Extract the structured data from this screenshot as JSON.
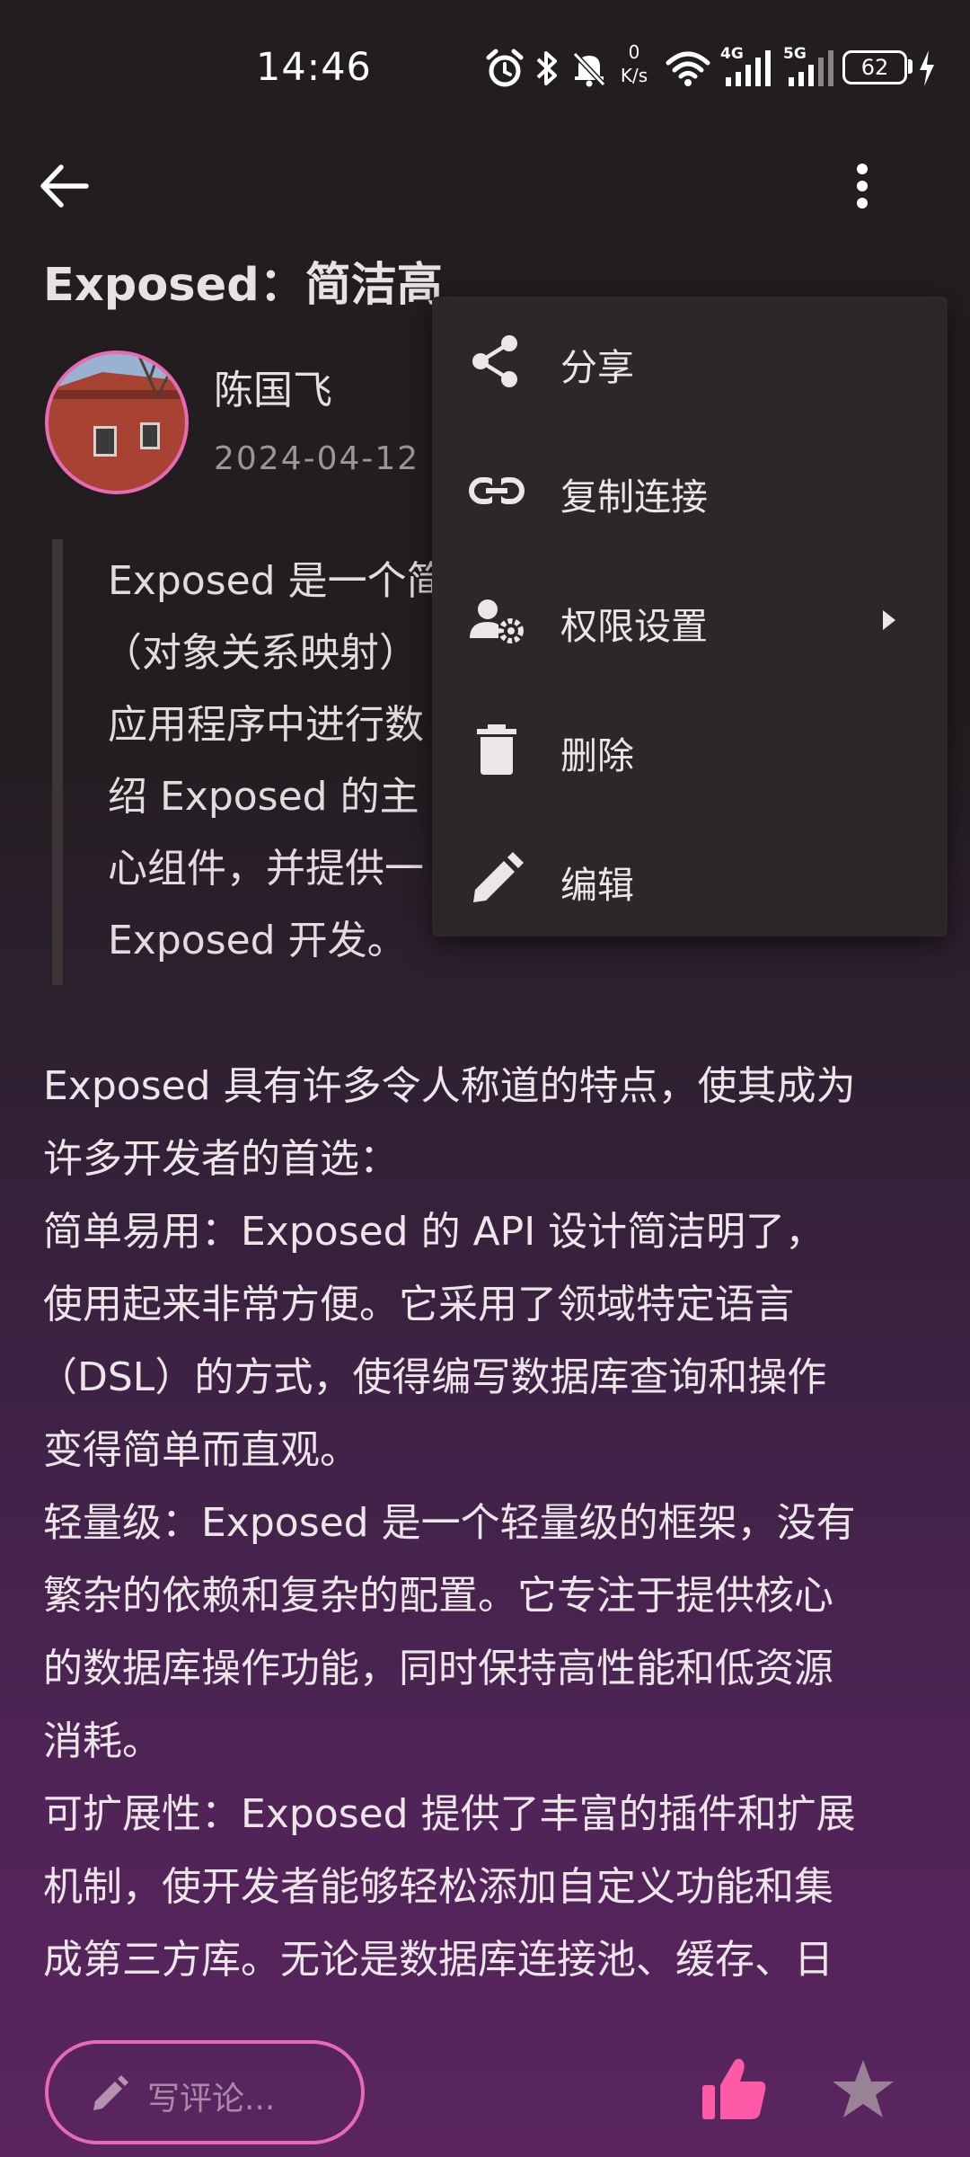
{
  "status_bar": {
    "time": "14:46",
    "net_speed_value": "0",
    "net_speed_unit": "K/s",
    "net_4g": "4G",
    "net_5g": "5G",
    "battery": "62",
    "icons": [
      "alarm-icon",
      "bluetooth-icon",
      "mute-icon",
      "wifi-icon",
      "signal-4g-icon",
      "signal-5g-icon",
      "battery-icon",
      "charging-icon"
    ]
  },
  "app_bar": {
    "back_icon": "arrow-back-icon",
    "more_icon": "more-vertical-icon"
  },
  "article": {
    "title": "Exposed：简洁高",
    "author": "陈国飞",
    "date": "2024-04-12",
    "quote_lines": [
      "Exposed 是一个简",
      "（对象关系映射）",
      "应用程序中进行数",
      "绍 Exposed 的主",
      "心组件，并提供一",
      "Exposed 开发。"
    ],
    "body_lines": [
      "Exposed 具有许多令人称道的特点，使其成为",
      "许多开发者的首选：",
      "简单易用：Exposed 的 API 设计简洁明了，",
      "使用起来非常方便。它采用了领域特定语言",
      "（DSL）的方式，使得编写数据库查询和操作",
      "变得简单而直观。",
      "轻量级：Exposed 是一个轻量级的框架，没有",
      "繁杂的依赖和复杂的配置。它专注于提供核心",
      "的数据库操作功能，同时保持高性能和低资源",
      "消耗。",
      "可扩展性：Exposed 提供了丰富的插件和扩展",
      "机制，使开发者能够轻松添加自定义功能和集",
      "成第三方库。无论是数据库连接池、缓存、日"
    ]
  },
  "menu": {
    "items": [
      {
        "label": "分享",
        "icon": "share-icon"
      },
      {
        "label": "复制连接",
        "icon": "link-icon"
      },
      {
        "label": "权限设置",
        "icon": "user-settings-icon",
        "has_submenu": true
      },
      {
        "label": "删除",
        "icon": "trash-icon"
      },
      {
        "label": "编辑",
        "icon": "pencil-icon"
      }
    ]
  },
  "bottom_bar": {
    "comment_placeholder": "写评论...",
    "comment_icon": "pencil-icon",
    "like_icon": "thumbs-up-icon",
    "favorite_icon": "star-icon"
  },
  "colors": {
    "accent": "#e86ab3",
    "like": "#ff5aa8",
    "menu_bg": "#2c2829",
    "background_top": "#221e20",
    "background_bottom": "#5a2560"
  }
}
